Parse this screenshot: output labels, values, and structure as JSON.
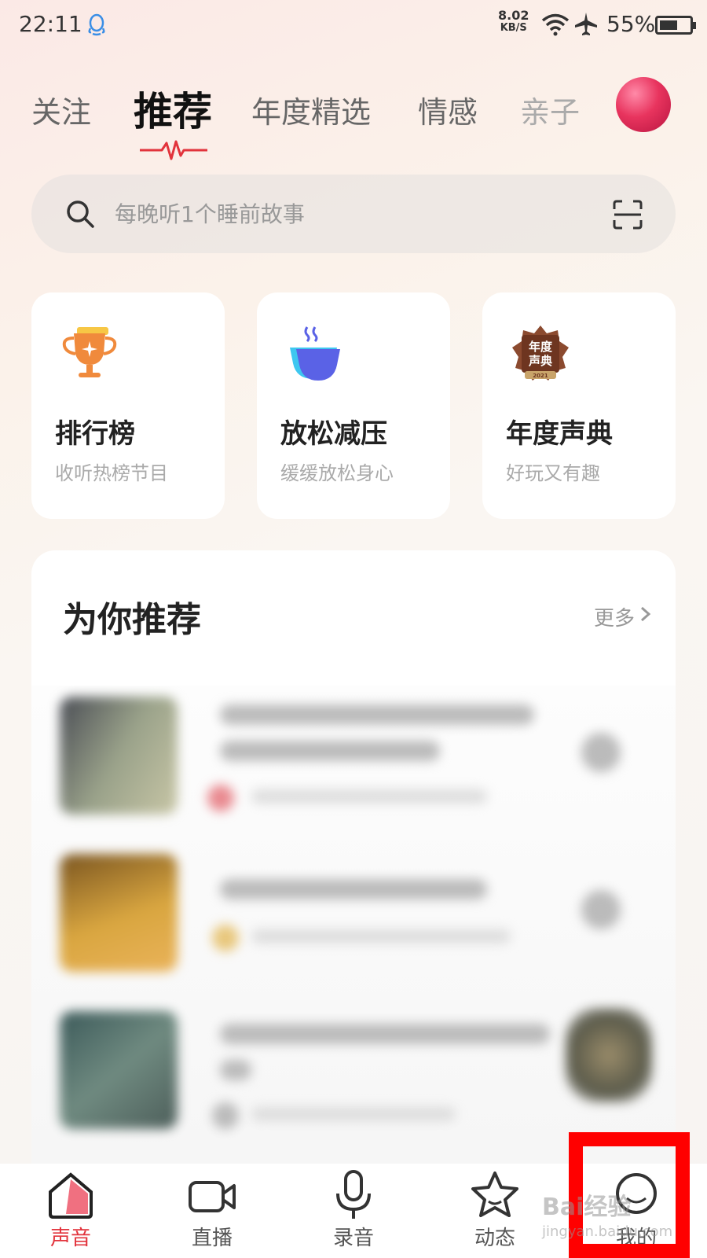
{
  "status_bar": {
    "time": "22:11",
    "speed_value": "8.02",
    "speed_unit": "KB/S",
    "battery": "55%"
  },
  "tabs": [
    {
      "label": "关注"
    },
    {
      "label": "推荐"
    },
    {
      "label": "年度精选"
    },
    {
      "label": "情感"
    },
    {
      "label": "亲子"
    }
  ],
  "search": {
    "placeholder": "每晚听1个睡前故事"
  },
  "cards": [
    {
      "title": "排行榜",
      "subtitle": "收听热榜节目",
      "icon": "trophy-icon"
    },
    {
      "title": "放松减压",
      "subtitle": "缓缓放松身心",
      "icon": "coffee-cup-icon"
    },
    {
      "title": "年度声典",
      "subtitle": "好玩又有趣",
      "icon": "annual-badge-icon"
    }
  ],
  "recommend": {
    "title": "为你推荐",
    "more": "更多"
  },
  "badge_text": "年度声典",
  "badge_year": "2021",
  "bottom_nav": [
    {
      "label": "声音",
      "icon": "home-sound-icon",
      "active": true
    },
    {
      "label": "直播",
      "icon": "video-camera-icon",
      "active": false
    },
    {
      "label": "录音",
      "icon": "microphone-icon",
      "active": false
    },
    {
      "label": "动态",
      "icon": "star-icon",
      "active": false
    },
    {
      "label": "我的",
      "icon": "profile-icon",
      "active": false
    }
  ],
  "watermark": "Bai经验",
  "watermark_url": "jingyan.baidu.com",
  "colors": {
    "accent": "#e2333c",
    "highlight_box": "#ff0000"
  }
}
